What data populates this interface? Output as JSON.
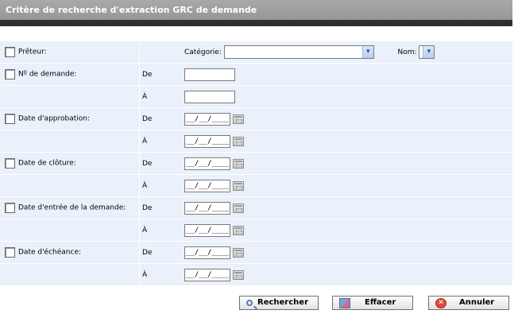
{
  "header": {
    "title": "Critère de recherche d'extraction GRC de demande"
  },
  "criteria": {
    "preteur": {
      "label": "Prêteur:",
      "categorie_label": "Catégorie:",
      "categorie_value": "",
      "nom_label": "Nom:",
      "nom_value": ""
    },
    "numero": {
      "label": "Nº de demande:",
      "from_label": "De",
      "to_label": "À",
      "from_value": "",
      "to_value": ""
    },
    "approbation": {
      "label": "Date d'approbation:",
      "from_label": "De",
      "to_label": "À",
      "from_value": "__/__/____",
      "to_value": "__/__/____"
    },
    "cloture": {
      "label": "Date de clôture:",
      "from_label": "De",
      "to_label": "À",
      "from_value": "__/__/____",
      "to_value": "__/__/____"
    },
    "entree": {
      "label": "Date d'entrée de la demande:",
      "from_label": "De",
      "to_label": "À",
      "from_value": "__/__/____",
      "to_value": "__/__/____"
    },
    "echeance": {
      "label": "Date d'échéance:",
      "from_label": "De",
      "to_label": "À",
      "from_value": "__/__/____",
      "to_value": "__/__/____"
    }
  },
  "buttons": {
    "search": "Rechercher",
    "clear": "Effacer",
    "cancel": "Annuler",
    "cancel_icon": "✕"
  },
  "icons": {
    "dropdown": "▾"
  }
}
